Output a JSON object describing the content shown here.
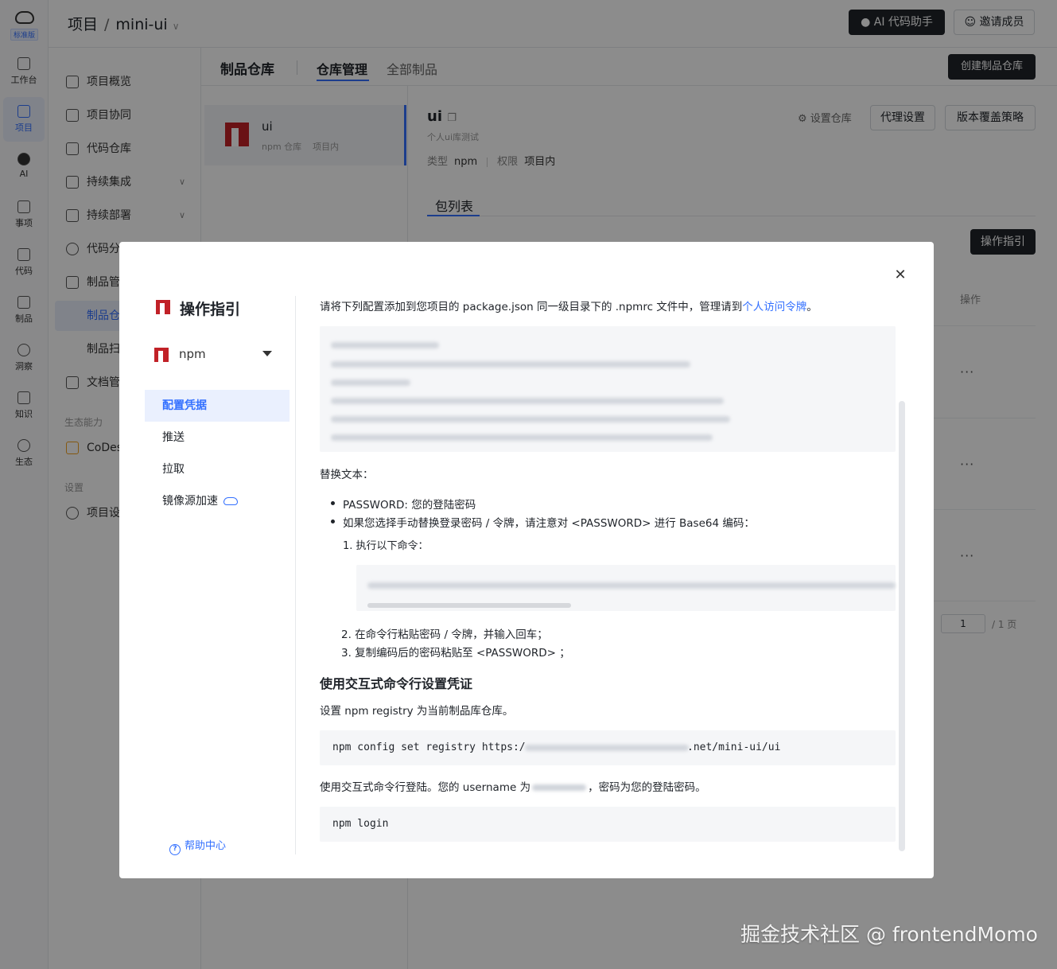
{
  "rail": {
    "edition_tag": "标准版",
    "items": [
      {
        "label": "工作台"
      },
      {
        "label": "项目"
      },
      {
        "label": "AI"
      },
      {
        "label": "事项"
      },
      {
        "label": "代码"
      },
      {
        "label": "制品"
      },
      {
        "label": "洞察"
      },
      {
        "label": "知识"
      },
      {
        "label": "生态"
      }
    ]
  },
  "breadcrumb": {
    "root": "项目",
    "separator": "/",
    "project": "mini-ui"
  },
  "header": {
    "ai_button": "AI 代码助手",
    "invite_button": "邀请成员"
  },
  "sidebar": {
    "items": [
      {
        "label": "项目概览"
      },
      {
        "label": "项目协同"
      },
      {
        "label": "代码仓库"
      },
      {
        "label": "持续集成"
      },
      {
        "label": "持续部署"
      },
      {
        "label": "代码分"
      },
      {
        "label": "制品管"
      },
      {
        "label": "制品仓"
      },
      {
        "label": "制品扫"
      },
      {
        "label": "文档管"
      }
    ],
    "group_ecosystem": "生态能力",
    "codes_item": "CoDes",
    "group_settings": "设置",
    "settings_item": "项目设"
  },
  "tabs": {
    "title": "制品仓库",
    "items": [
      "仓库管理",
      "全部制品"
    ],
    "create_button": "创建制品仓库"
  },
  "repo_card": {
    "name": "ui",
    "type": "npm 仓库",
    "scope": "项目内"
  },
  "detail": {
    "name": "ui",
    "description": "个人ui库测试",
    "type_label": "类型",
    "type_value": "npm",
    "perm_label": "权限",
    "perm_value": "项目内",
    "settings_link": "设置仓库",
    "proxy_button": "代理设置",
    "version_button": "版本覆盖策略",
    "package_tab": "包列表",
    "guide_button": "操作指引",
    "operation_header": "操作",
    "page_current": "1",
    "page_total": "/ 1 页"
  },
  "modal": {
    "title": "操作指引",
    "selected_type": "npm",
    "nav": [
      "配置凭据",
      "推送",
      "拉取",
      "镜像源加速"
    ],
    "help": "帮助中心",
    "intro_prefix": "请将下列配置添加到您项目的 package.json 同一级目录下的 .npmrc 文件中，管理请到",
    "intro_link": "个人访问令牌",
    "intro_suffix": "。",
    "replace_heading": "替换文本：",
    "bullet_1": "PASSWORD: 您的登陆密码",
    "bullet_2": "如果您选择手动替换登录密码 / 令牌，请注意对 <PASSWORD> 进行 Base64 编码：",
    "step_1": "1. 执行以下命令：",
    "step_2": "2. 在命令行粘贴密码 / 令牌，并输入回车；",
    "step_3": "3. 复制编码后的密码粘贴至 <PASSWORD> ；",
    "interactive_heading": "使用交互式命令行设置凭证",
    "set_registry_text": "设置 npm registry 为当前制品库仓库。",
    "registry_cmd_prefix": "npm config set registry https:/",
    "registry_cmd_suffix": ".net/mini-ui/ui",
    "login_text_prefix": "使用交互式命令行登陆。您的 username 为",
    "login_text_suffix": "，密码为您的登陆密码。",
    "login_cmd": "npm login"
  },
  "watermark": "掘金技术社区 @ frontendMomo"
}
